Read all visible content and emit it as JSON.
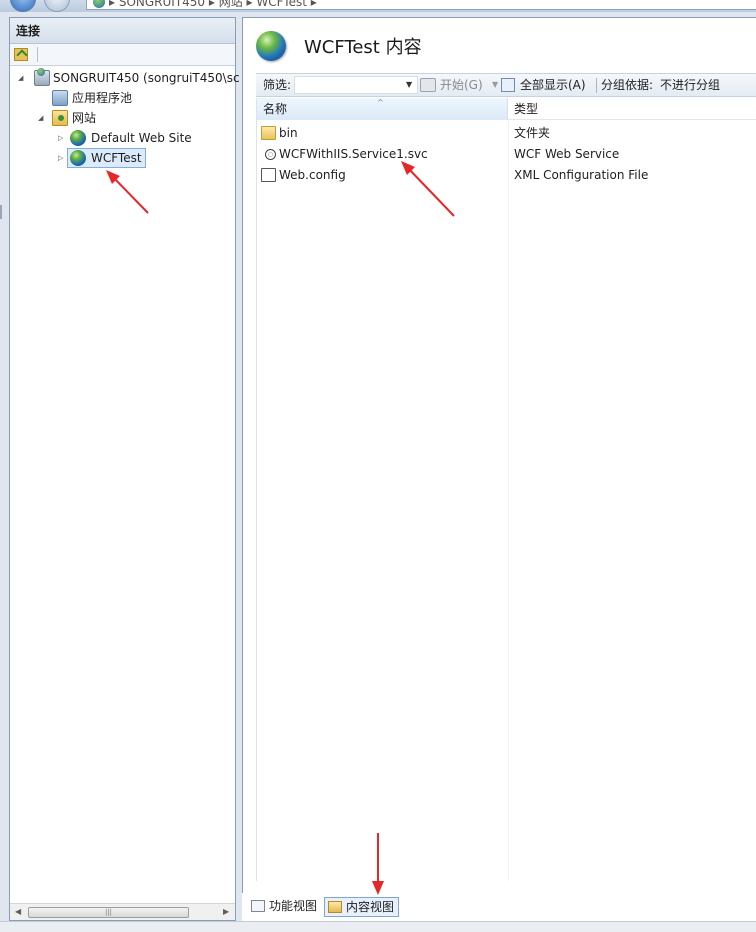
{
  "address_bar": {
    "segments": "▸ SONGRUIT450 ▸ 网站 ▸ WCFTest ▸"
  },
  "connections": {
    "title": "连接",
    "tree": [
      {
        "label": "SONGRUIT450 (songruiT450\\sc",
        "icon": "server-icon",
        "expanded": true
      },
      {
        "label": "应用程序池",
        "icon": "app-pool-icon"
      },
      {
        "label": "网站",
        "icon": "sites-folder-icon",
        "expanded": true
      },
      {
        "label": "Default Web Site",
        "icon": "globe-icon",
        "expanded": false
      },
      {
        "label": "WCFTest",
        "icon": "globe-icon",
        "expanded": false,
        "selected": true
      }
    ]
  },
  "main": {
    "title": "WCFTest 内容",
    "filter": {
      "label": "筛选:",
      "value": "",
      "start_label": "开始(G)",
      "show_all_label": "全部显示(A)",
      "group_by_label": "分组依据:",
      "group_by_value": "不进行分组"
    },
    "columns": [
      "名称",
      "类型"
    ],
    "rows": [
      {
        "name": "bin",
        "type": "文件夹",
        "icon": "folder-icon"
      },
      {
        "name": "WCFWithIIS.Service1.svc",
        "type": "WCF Web Service",
        "icon": "svc-file-icon"
      },
      {
        "name": "Web.config",
        "type": "XML Configuration File",
        "icon": "config-file-icon"
      }
    ]
  },
  "bottom_tabs": [
    {
      "label": "功能视图",
      "active": false
    },
    {
      "label": "内容视图",
      "active": true
    }
  ],
  "colors": {
    "annotation_arrow": "#e8262a",
    "selection_fill": "#dcebfc",
    "header_gradient": "#dbeaf8"
  }
}
